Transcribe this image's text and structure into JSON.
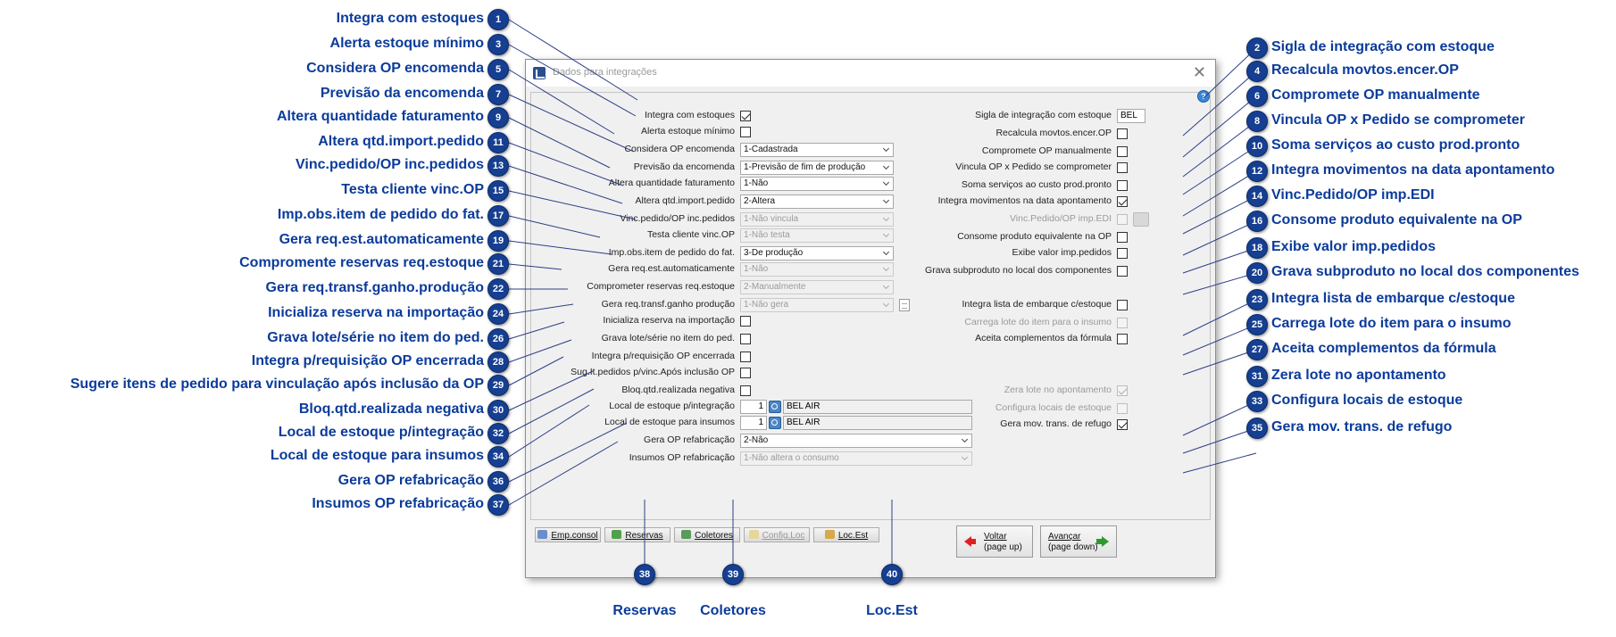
{
  "dialog": {
    "title": "Dados para integrações",
    "left": [
      {
        "label": "Integra com estoques",
        "checked": true
      },
      {
        "label": "Alerta estoque mínimo",
        "checked": false
      },
      {
        "label": "Considera OP encomenda",
        "value": "1-Cadastrada"
      },
      {
        "label": "Previsão da encomenda",
        "value": "1-Previsão de fim de produção"
      },
      {
        "label": "Altera quantidade faturamento",
        "value": "1-Não"
      },
      {
        "label": "Altera qtd.import.pedido",
        "value": "2-Altera"
      },
      {
        "label": "Vinc.pedido/OP inc.pedidos",
        "value": "1-Não vincula",
        "disabled": true
      },
      {
        "label": "Testa cliente vinc.OP",
        "value": "1-Não testa",
        "disabled": true
      },
      {
        "label": "Imp.obs.item de pedido do fat.",
        "value": "3-De produção"
      },
      {
        "label": "Gera req.est.automaticamente",
        "value": "1-Não",
        "disabled": true
      },
      {
        "label": "Comprometer reservas req.estoque",
        "value": "2-Manualmente",
        "disabled": true
      },
      {
        "label": "Gera req.transf.ganho produção",
        "value": "1-Não gera",
        "disabled": true
      },
      {
        "label": "Inicializa reserva na importação",
        "checked": false
      },
      {
        "label": "Grava lote/série no item do ped.",
        "checked": false
      },
      {
        "label": "Integra p/requisição OP encerrada",
        "checked": false
      },
      {
        "label": "Sug.It.pedidos p/vinc.Após inclusão OP",
        "checked": false
      },
      {
        "label": "Bloq.qtd.realizada negativa",
        "checked": false
      },
      {
        "label": "Local de estoque p/integração",
        "num": "1",
        "name": "BEL AIR"
      },
      {
        "label": "Local de estoque para insumos",
        "num": "1",
        "name": "BEL AIR"
      },
      {
        "label": "Gera OP refabricação",
        "value": "2-Não"
      },
      {
        "label": "Insumos OP refabricação",
        "value": "1-Não altera o consumo",
        "disabled": true
      }
    ],
    "right": [
      {
        "label": "Sigla de integração com estoque",
        "value": "BEL"
      },
      {
        "label": "Recalcula movtos.encer.OP",
        "checked": false
      },
      {
        "label": "Compromete OP manualmente",
        "checked": false
      },
      {
        "label": "Vincula OP x Pedido se comprometer",
        "checked": false
      },
      {
        "label": "Soma serviços ao custo prod.pronto",
        "checked": false
      },
      {
        "label": "Integra movimentos na data apontamento",
        "checked": true
      },
      {
        "label": "Vinc.Pedido/OP imp.EDI",
        "checked": false,
        "disabled": true
      },
      {
        "label": "Consome produto equivalente na OP",
        "checked": false
      },
      {
        "label": "Exibe valor imp.pedidos",
        "checked": false
      },
      {
        "label": "Grava subproduto no local dos componentes",
        "checked": false
      },
      {
        "label": "Integra lista de embarque c/estoque",
        "checked": false
      },
      {
        "label": "Carrega lote do item para o insumo",
        "checked": false,
        "disabled": true
      },
      {
        "label": "Aceita complementos da fórmula",
        "checked": false
      },
      {
        "label": "Zera lote no apontamento",
        "checked": true,
        "disabled": true
      },
      {
        "label": "Configura locais de estoque",
        "checked": false,
        "disabled": true
      },
      {
        "label": "Gera mov. trans. de refugo",
        "checked": true
      }
    ],
    "buttons": {
      "emp_consol": "Emp.consol",
      "reservas": "Reservas",
      "coletores": "Coletores",
      "config_loc": "Config.Loc",
      "loc_est": "Loc.Est",
      "voltar_1": "Voltar",
      "voltar_2": "(page up)",
      "avancar_1": "Avançar",
      "avancar_2": "(page down)"
    }
  },
  "callouts": [
    {
      "n": "1",
      "label": "Integra com estoques"
    },
    {
      "n": "2",
      "label": "Sigla de integração com estoque"
    },
    {
      "n": "3",
      "label": "Alerta estoque mínimo"
    },
    {
      "n": "4",
      "label": "Recalcula movtos.encer.OP"
    },
    {
      "n": "5",
      "label": "Considera OP encomenda"
    },
    {
      "n": "6",
      "label": "Compromete OP manualmente"
    },
    {
      "n": "7",
      "label": "Previsão da encomenda"
    },
    {
      "n": "8",
      "label": "Vincula OP x Pedido se comprometer"
    },
    {
      "n": "9",
      "label": "Altera quantidade faturamento"
    },
    {
      "n": "10",
      "label": "Soma serviços ao custo prod.pronto"
    },
    {
      "n": "11",
      "label": "Altera qtd.import.pedido"
    },
    {
      "n": "12",
      "label": "Integra movimentos na data apontamento"
    },
    {
      "n": "13",
      "label": "Vinc.pedido/OP inc.pedidos"
    },
    {
      "n": "14",
      "label": "Vinc.Pedido/OP imp.EDI"
    },
    {
      "n": "15",
      "label": "Testa cliente vinc.OP"
    },
    {
      "n": "16",
      "label": "Consome produto equivalente na OP"
    },
    {
      "n": "17",
      "label": "Imp.obs.item de pedido do fat."
    },
    {
      "n": "18",
      "label": "Exibe valor imp.pedidos"
    },
    {
      "n": "19",
      "label": "Gera req.est.automaticamente"
    },
    {
      "n": "20",
      "label": "Grava subproduto no local dos componentes"
    },
    {
      "n": "21",
      "label": "Compromente reservas req.estoque"
    },
    {
      "n": "22",
      "label": "Gera req.transf.ganho.produção"
    },
    {
      "n": "23",
      "label": "Integra lista de embarque c/estoque"
    },
    {
      "n": "24",
      "label": "Inicializa reserva na importação"
    },
    {
      "n": "25",
      "label": "Carrega lote do item para o insumo"
    },
    {
      "n": "26",
      "label": "Grava lote/série no item do ped."
    },
    {
      "n": "27",
      "label": "Aceita complementos da fórmula"
    },
    {
      "n": "28",
      "label": "Integra p/requisição OP encerrada"
    },
    {
      "n": "29",
      "label": "Sugere itens de pedido para vinculação após inclusão da OP"
    },
    {
      "n": "30",
      "label": "Bloq.qtd.realizada negativa"
    },
    {
      "n": "31",
      "label": "Zera lote no apontamento"
    },
    {
      "n": "32",
      "label": "Local de estoque p/integração"
    },
    {
      "n": "33",
      "label": "Configura locais de estoque"
    },
    {
      "n": "34",
      "label": "Local de estoque para insumos"
    },
    {
      "n": "35",
      "label": "Gera mov. trans. de refugo"
    },
    {
      "n": "36",
      "label": "Gera OP refabricação"
    },
    {
      "n": "37",
      "label": "Insumos OP refabricação"
    },
    {
      "n": "38",
      "label": "Reservas"
    },
    {
      "n": "39",
      "label": "Coletores"
    },
    {
      "n": "40",
      "label": "Loc.Est"
    }
  ]
}
